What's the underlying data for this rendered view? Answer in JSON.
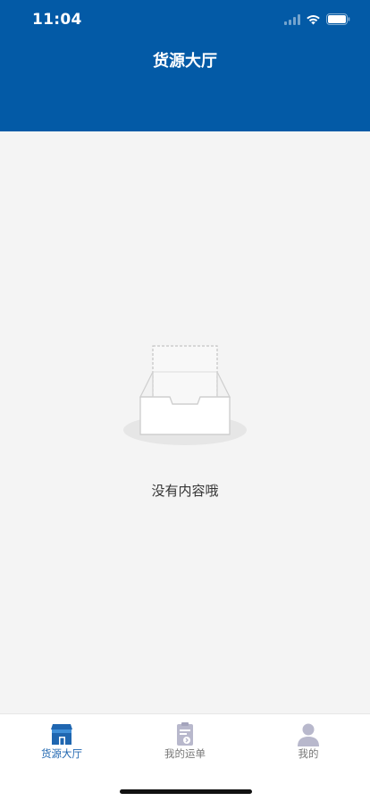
{
  "status_bar": {
    "time": "11:04",
    "icons": [
      "cellular-signal-icon",
      "wifi-icon",
      "battery-icon"
    ]
  },
  "header": {
    "title": "货源大厅",
    "background_color": "#035aa6"
  },
  "empty_state": {
    "icon": "empty-box-icon",
    "message": "没有内容哦"
  },
  "tab_bar": {
    "tabs": [
      {
        "label": "货源大厅",
        "icon": "storefront-icon",
        "active": true
      },
      {
        "label": "我的运单",
        "icon": "clipboard-waybill-icon",
        "active": false
      },
      {
        "label": "我的",
        "icon": "user-profile-icon",
        "active": false
      }
    ],
    "active_color": "#1f66b0",
    "inactive_color": "#b8b8cc"
  }
}
